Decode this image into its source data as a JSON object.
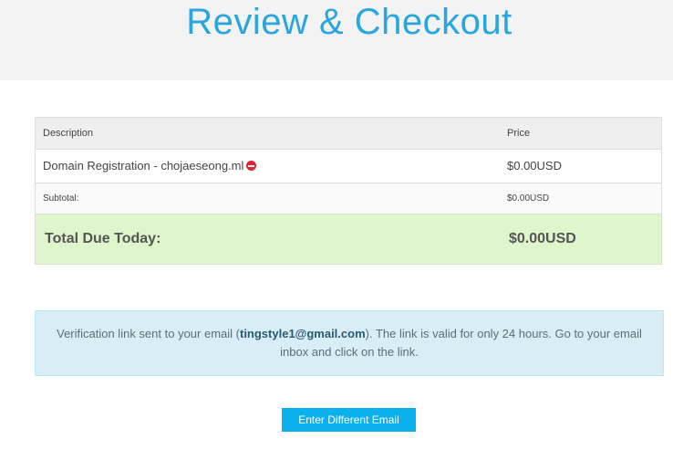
{
  "header": {
    "title": "Review & Checkout"
  },
  "cart": {
    "columns": {
      "description": "Description",
      "price": "Price"
    },
    "items": [
      {
        "description": "Domain Registration - chojaeseong.ml",
        "price": "$0.00USD",
        "remove_icon": "remove-icon"
      }
    ],
    "subtotal": {
      "label": "Subtotal:",
      "value": "$0.00USD"
    },
    "total": {
      "label": "Total Due Today:",
      "value": "$0.00USD"
    }
  },
  "notice": {
    "text_before": "Verification link sent to your email (",
    "email": "tingstyle1@gmail.com",
    "text_after": "). The link is valid for only 24 hours. Go to your email inbox and click on the link."
  },
  "actions": {
    "change_email_label": "Enter Different Email"
  },
  "colors": {
    "title": "#2aa6df",
    "total_row_bg": "#dff5cc",
    "alert_bg": "#d9edf7",
    "button_bg": "#0bb1ec",
    "remove_icon": "#e0242b"
  }
}
